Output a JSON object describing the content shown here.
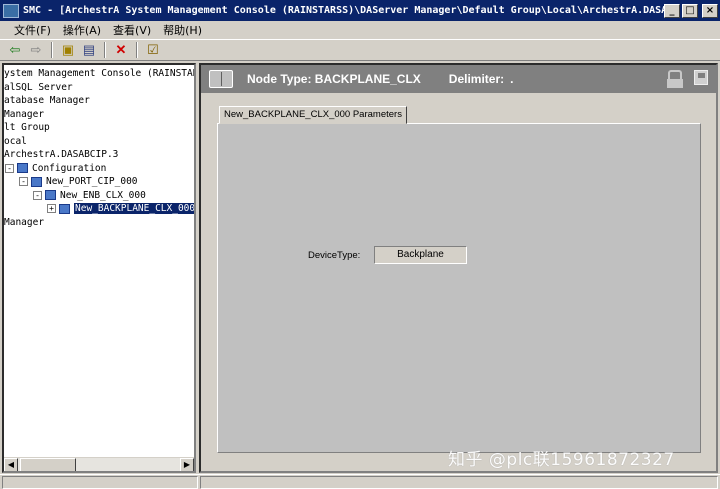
{
  "window": {
    "title": "SMC - [ArchestrA System Management Console (RAINSTARSS)\\DAServer Manager\\Default Group\\Local\\ArchestrA.DASA...",
    "min_glyph": "_",
    "max_glyph": "□",
    "close_glyph": "×"
  },
  "menu": [
    "文件(F)",
    "操作(A)",
    "查看(V)",
    "帮助(H)"
  ],
  "toolbar": {
    "back": "⇦",
    "forward": "⇨",
    "up": "▣",
    "view": "▤",
    "delete": "✕",
    "properties": "☑"
  },
  "tree": [
    {
      "label": "ystem Management Console (RAINSTARSS)",
      "indent": 0
    },
    {
      "label": "alSQL Server",
      "indent": 0
    },
    {
      "label": "atabase Manager",
      "indent": 0
    },
    {
      "label": " Manager",
      "indent": 0
    },
    {
      "label": "lt Group",
      "indent": 0
    },
    {
      "label": "ocal",
      "indent": 0
    },
    {
      "label": " ArchestrA.DASABCIP.3",
      "indent": 0
    },
    {
      "label": "Configuration",
      "indent": 1,
      "expander": "-"
    },
    {
      "label": "New_PORT_CIP_000",
      "indent": 2,
      "expander": "-"
    },
    {
      "label": "New_ENB_CLX_000",
      "indent": 3,
      "expander": "-"
    },
    {
      "label": "New_BACKPLANE_CLX_000",
      "indent": 4,
      "expander": "+",
      "selected": true
    },
    {
      "label": " Manager",
      "indent": 0
    }
  ],
  "detail": {
    "node_type_label": "Node Type: BACKPLANE_CLX",
    "delimiter_label": "Delimiter:",
    "delimiter_value": ".",
    "tab_label": "New_BACKPLANE_CLX_000 Parameters",
    "device_type_label": "DeviceType:",
    "device_type_value": "Backplane"
  },
  "watermark": "知乎 @plc联15961872327",
  "colors": {
    "titlebar": "#0a246a",
    "panel_header": "#808080",
    "selection": "#0a246a",
    "face": "#d4d0c8"
  }
}
